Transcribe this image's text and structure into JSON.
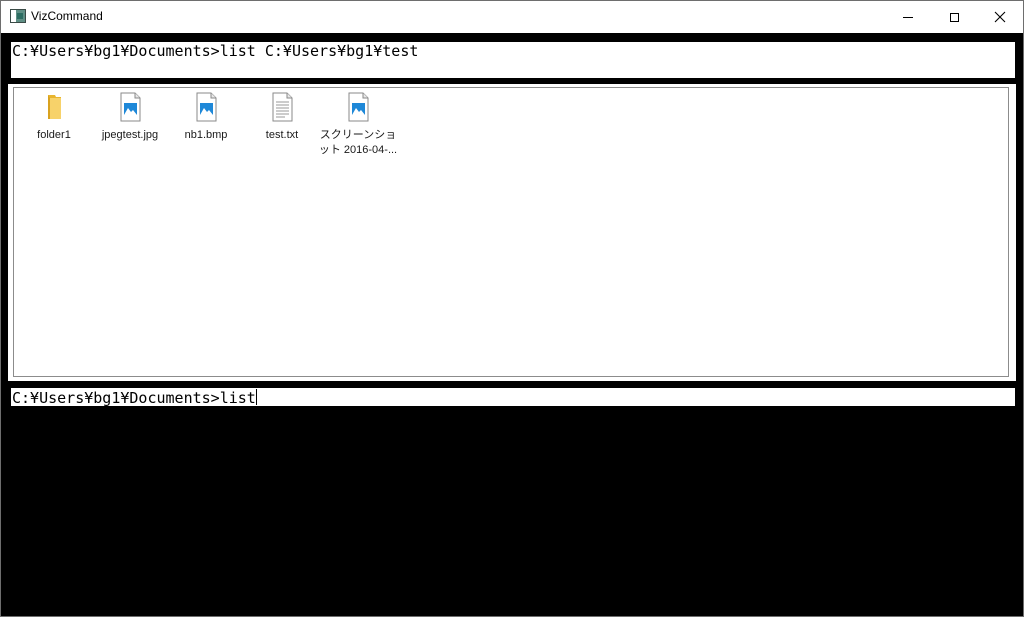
{
  "window": {
    "title": "VizCommand"
  },
  "history": {
    "command": "C:¥Users¥bg1¥Documents>list C:¥Users¥bg1¥test"
  },
  "listing": {
    "items": [
      {
        "label": "folder1",
        "icon": "folder-icon"
      },
      {
        "label": "jpegtest.jpg",
        "icon": "image-file-icon"
      },
      {
        "label": "nb1.bmp",
        "icon": "image-file-icon"
      },
      {
        "label": "test.txt",
        "icon": "text-file-icon"
      },
      {
        "label": "スクリーンショット 2016-04-...",
        "icon": "image-file-icon"
      }
    ]
  },
  "prompt": {
    "value": "C:¥Users¥bg1¥Documents>list"
  },
  "colors": {
    "console_background": "#000000",
    "folder": "#f5c842",
    "image_icon_accent": "#1e88d8"
  }
}
